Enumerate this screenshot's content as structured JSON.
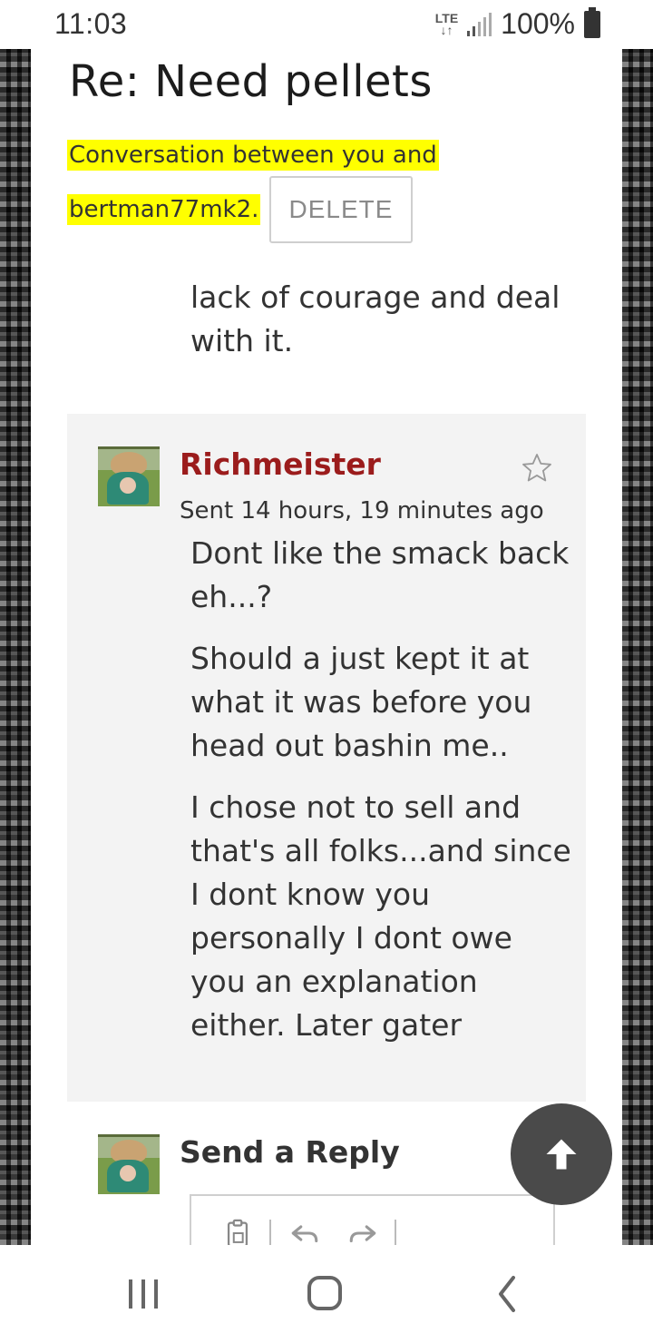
{
  "status_bar": {
    "time": "11:03",
    "network": "LTE",
    "battery": "100%"
  },
  "page": {
    "title": "Re: Need pellets",
    "conversation_line1": "Conversation between you and",
    "conversation_line2": "bertman77mk2.",
    "delete_label": "DELETE",
    "previous_message_tail": "lack of courage and deal with it."
  },
  "message": {
    "sender": "Richmeister",
    "sent": "Sent 14 hours, 19 minutes ago",
    "paragraphs": [
      "Dont like the smack back eh...?",
      "Should a just kept it at what it was before you head out bashin me..",
      "I chose not to sell and that's all folks...and since I dont know you personally I dont owe you an explanation either.   Later gater"
    ]
  },
  "reply": {
    "heading": "Send a Reply"
  },
  "colors": {
    "highlight": "#ffff00",
    "sender_name": "#9b1c1c",
    "message_bg": "#f3f3f3",
    "scroll_button": "#4a4a4a"
  },
  "icons": {
    "favorite": "star-icon",
    "scroll_top": "arrow-up-icon",
    "nav_recent": "recent-apps-icon",
    "nav_home": "home-icon",
    "nav_back": "back-icon"
  }
}
